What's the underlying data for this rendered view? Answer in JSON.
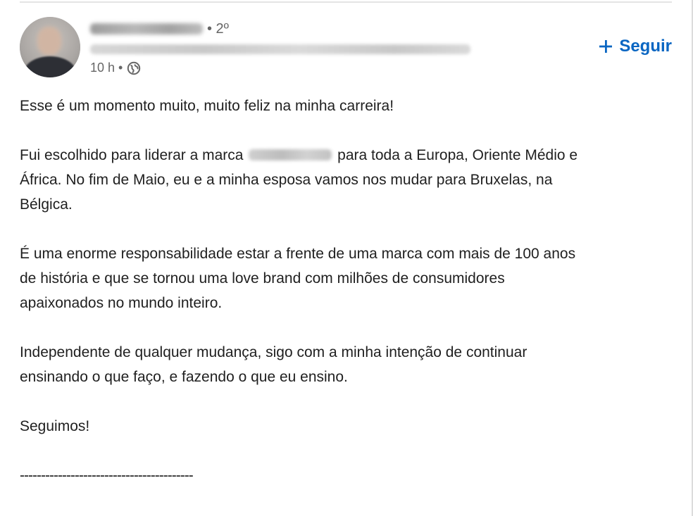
{
  "author": {
    "degree": "• 2º",
    "time": "10 h •",
    "icons": {
      "globe": "globe-icon"
    }
  },
  "follow": {
    "label": "Seguir",
    "icon": "plus-icon",
    "color": "#0a66c2"
  },
  "post": {
    "p1": "Esse é um momento muito, muito feliz na minha carreira!",
    "p2_before": "Fui escolhido para liderar a marca",
    "p2_after": "para toda a Europa, Oriente Médio e",
    "p2_line2": "África. No fim de Maio, eu e a minha esposa vamos nos mudar para Bruxelas, na",
    "p2_line3": "Bélgica.",
    "p3_line1": "É uma enorme responsabilidade estar a frente de uma marca com mais de 100 anos",
    "p3_line2": "de história e que se tornou uma love brand com milhões de consumidores",
    "p3_line3": "apaixonados no mundo inteiro.",
    "p4_line1": "Independente de qualquer mudança, sigo com a minha intenção de continuar",
    "p4_line2": "ensinando o que faço, e fazendo o que eu ensino.",
    "p5": "Seguimos!",
    "divider": "-----------------------------------------"
  }
}
